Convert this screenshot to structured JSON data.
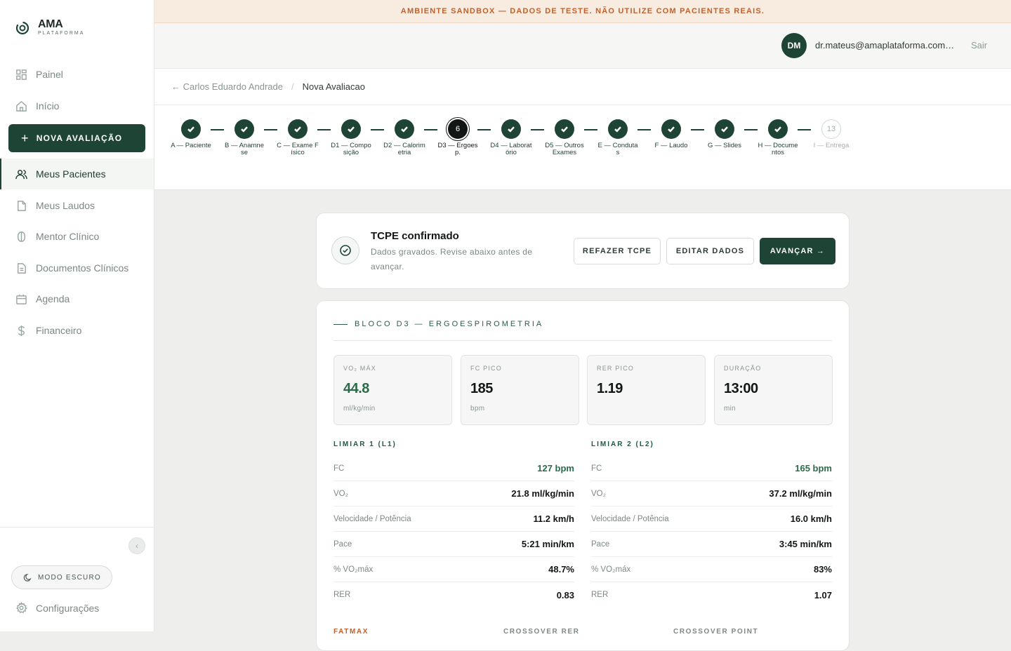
{
  "brand": {
    "title": "AMA",
    "subtitle": "PLATAFORMA"
  },
  "sidebar": {
    "items": [
      {
        "label": "Painel",
        "icon": "grid-icon"
      },
      {
        "label": "Início",
        "icon": "home-icon"
      },
      {
        "label": "Meus Pacientes",
        "icon": "users-icon",
        "active": true
      },
      {
        "label": "Meus Laudos",
        "icon": "file-icon"
      },
      {
        "label": "Mentor Clínico",
        "icon": "mentor-icon"
      },
      {
        "label": "Documentos Clínicos",
        "icon": "document-icon"
      },
      {
        "label": "Agenda",
        "icon": "calendar-icon"
      },
      {
        "label": "Financeiro",
        "icon": "dollar-icon"
      }
    ],
    "new_button": "NOVA AVALIAÇÃO",
    "dark_mode": "MODO ESCURO",
    "settings": "Configurações"
  },
  "banner": "AMBIENTE SANDBOX — DADOS DE TESTE. NÃO UTILIZE COM PACIENTES REAIS.",
  "user": {
    "initials": "DM",
    "email": "dr.mateus@amaplataforma.com.br",
    "logout": "Sair"
  },
  "breadcrumb": {
    "back": "← Carlos Eduardo Andrade",
    "separator": "/",
    "current": "Nova Avaliacao"
  },
  "steps": [
    {
      "label": "A — Paciente",
      "state": "done"
    },
    {
      "label": "B — Anamnese",
      "state": "done"
    },
    {
      "label": "C — Exame Físico",
      "state": "done"
    },
    {
      "label": "D1 — Composição",
      "state": "done"
    },
    {
      "label": "D2 — Calorimetria",
      "state": "done"
    },
    {
      "label": "D3 — Ergoesp.",
      "state": "current",
      "number": "6"
    },
    {
      "label": "D4 — Laboratório",
      "state": "done"
    },
    {
      "label": "D5 — Outros Exames",
      "state": "done"
    },
    {
      "label": "E — Condutas",
      "state": "done"
    },
    {
      "label": "F — Laudo",
      "state": "done"
    },
    {
      "label": "G — Slides",
      "state": "done"
    },
    {
      "label": "H — Documentos",
      "state": "done"
    },
    {
      "label": "I — Entrega",
      "state": "pending",
      "number": "13"
    }
  ],
  "confirm": {
    "title": "TCPE confirmado",
    "subtitle": "Dados gravados. Revise abaixo antes de avançar.",
    "redo": "REFAZER TCPE",
    "edit": "EDITAR DADOS",
    "advance": "AVANÇAR →"
  },
  "block": {
    "title": "BLOCO D3 — ERGOESPIROMETRIA",
    "metrics": [
      {
        "label": "VO₂ MÁX",
        "value": "44.8",
        "unit": "ml/kg/min"
      },
      {
        "label": "FC PICO",
        "value": "185",
        "unit": "bpm"
      },
      {
        "label": "RER PICO",
        "value": "1.19",
        "unit": ""
      },
      {
        "label": "DURAÇÃO",
        "value": "13:00",
        "unit": "min"
      }
    ],
    "l1": {
      "title": "LIMIAR 1 (L1)",
      "rows": [
        {
          "k": "FC",
          "v": "127 bpm"
        },
        {
          "k": "VO₂",
          "v": "21.8 ml/kg/min"
        },
        {
          "k": "Velocidade / Potência",
          "v": "11.2 km/h"
        },
        {
          "k": "Pace",
          "v": "5:21 min/km"
        },
        {
          "k": "% VO₂máx",
          "v": "48.7%"
        },
        {
          "k": "RER",
          "v": "0.83"
        }
      ]
    },
    "l2": {
      "title": "LIMIAR 2 (L2)",
      "rows": [
        {
          "k": "FC",
          "v": "165 bpm"
        },
        {
          "k": "VO₂",
          "v": "37.2 ml/kg/min"
        },
        {
          "k": "Velocidade / Potência",
          "v": "16.0 km/h"
        },
        {
          "k": "Pace",
          "v": "3:45 min/km"
        },
        {
          "k": "% VO₂máx",
          "v": "83%"
        },
        {
          "k": "RER",
          "v": "1.07"
        }
      ]
    },
    "bottom": [
      "FATMAX",
      "CROSSOVER RER",
      "CROSSOVER POINT"
    ]
  },
  "colors": {
    "accent": "#1d4434",
    "warning": "#c0612d",
    "value_green": "#2b6b49"
  }
}
